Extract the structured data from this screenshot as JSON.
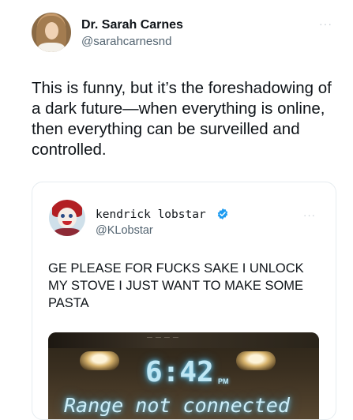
{
  "tweet": {
    "author": {
      "display_name": "Dr. Sarah Carnes",
      "handle": "@sarahcarnesnd",
      "avatar_icon": "profile-photo"
    },
    "more_label": "···",
    "text": "This is funny, but it’s the foreshadowing of a dark future—when everything is online, then everything can be surveilled and controlled."
  },
  "quoted_tweet": {
    "author": {
      "display_name": "kendrick lobstar",
      "handle": "@KLobstar",
      "verified": true,
      "avatar_icon": "clown-avatar"
    },
    "more_label": "···",
    "text": "GE PLEASE FOR FUCKS SAKE I UNLOCK MY STOVE I JUST WANT TO MAKE SOME PASTA",
    "media": {
      "clock": "6:42",
      "ampm": "PM",
      "top_strip_text": "— — — —",
      "scrolling_text": "Range not connected"
    }
  },
  "colors": {
    "text_primary": "#0f1419",
    "text_secondary": "#536471",
    "border": "#e6ecf0",
    "verified_blue": "#1d9bf0"
  }
}
